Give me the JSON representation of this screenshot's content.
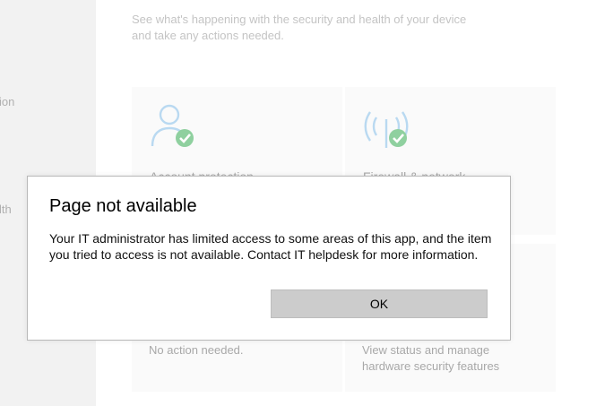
{
  "sidebar": {
    "items": [
      {
        "label": "ion"
      },
      {
        "label": "lth"
      }
    ]
  },
  "header": {
    "subtitle": "See what's happening with the security and health of your device and take any actions needed."
  },
  "tiles": [
    {
      "title": "Account protection",
      "status": "",
      "icon": "person-icon"
    },
    {
      "title": "Firewall & network",
      "status": "",
      "icon": "wireless-icon"
    },
    {
      "title": "",
      "status": "No action needed.",
      "icon": ""
    },
    {
      "title": "",
      "status": "View status and manage\nhardware security features",
      "icon": ""
    }
  ],
  "dialog": {
    "title": "Page not available",
    "message": "Your IT administrator has limited access to some areas of this app, and the item you tried to access is not available. Contact IT helpdesk for more information.",
    "ok_label": "OK"
  },
  "colors": {
    "icon_blue": "#8ec1e6",
    "check_green": "#5cb85c",
    "button_gray": "#cccccc"
  }
}
